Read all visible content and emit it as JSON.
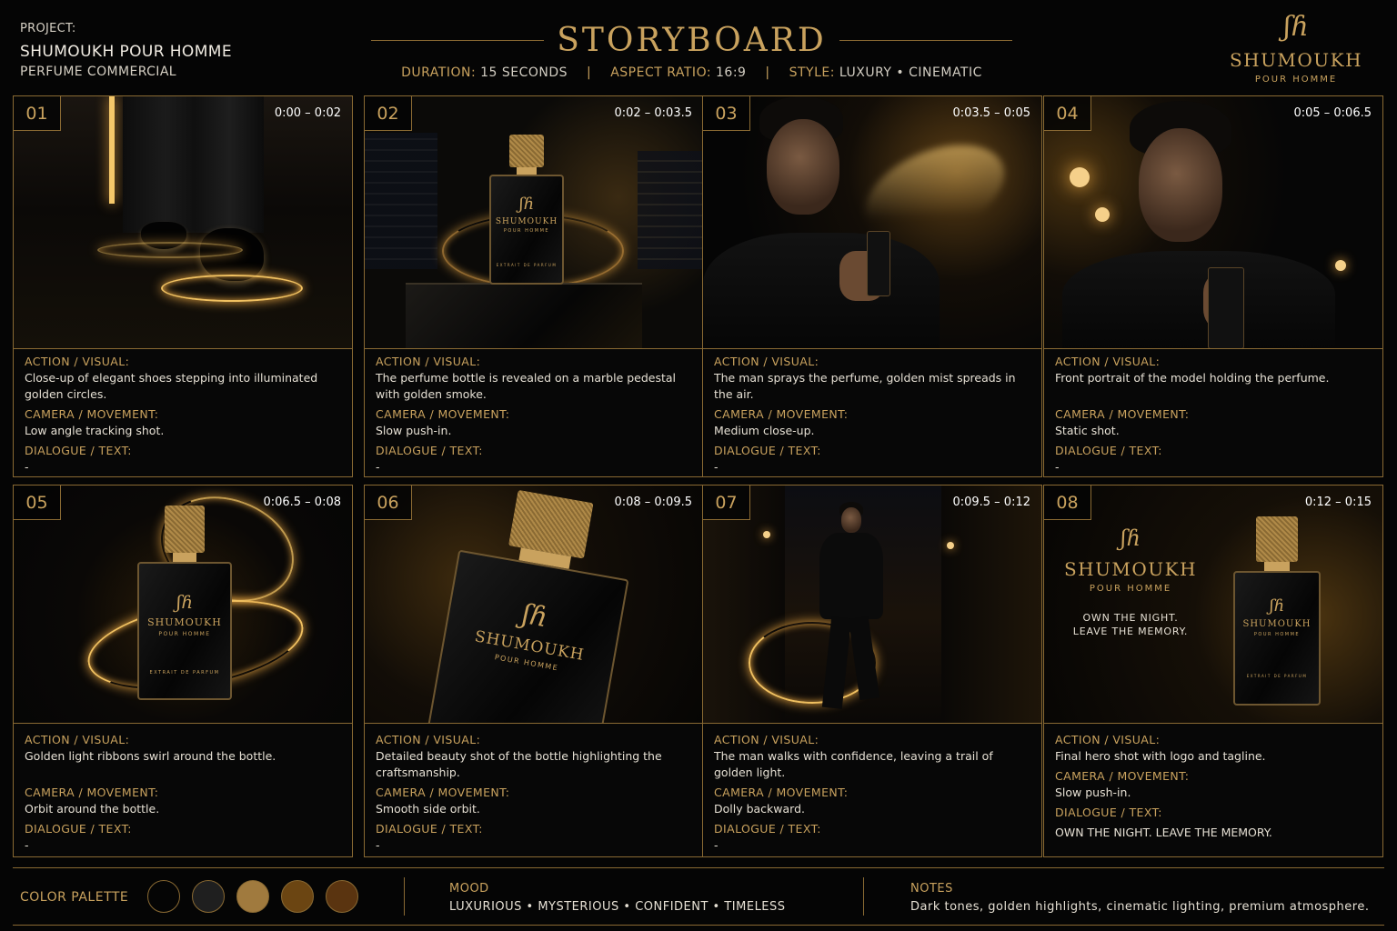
{
  "header": {
    "project_label": "PROJECT:",
    "project_name_bold": "SHUMOUKH",
    "project_name_rest": "POUR HOMME",
    "project_sub": "PERFUME COMMERCIAL",
    "title": "STORYBOARD",
    "duration_key": "DURATION:",
    "duration_val": "15 SECONDS",
    "aspect_key": "ASPECT RATIO:",
    "aspect_val": "16:9",
    "style_key": "STYLE:",
    "style_val": "LUXURY • CINEMATIC",
    "separator": "|"
  },
  "brand": {
    "monogram": "ʃɦ",
    "name": "SHUMOUKH",
    "sub": "POUR HOMME"
  },
  "labels": {
    "action": "ACTION / VISUAL:",
    "camera": "CAMERA / MOVEMENT:",
    "dialogue": "DIALOGUE / TEXT:"
  },
  "bottle_label": {
    "name": "SHUMOUKH",
    "sub": "POUR HOMME",
    "extrait": "EXTRAIT DE PARFUM"
  },
  "panels": [
    {
      "num": "01",
      "time": "0:00 – 0:02",
      "action": "Close-up of elegant shoes stepping into illuminated golden circles.",
      "camera": "Low angle tracking shot.",
      "dialogue": "-"
    },
    {
      "num": "02",
      "time": "0:02 – 0:03.5",
      "action": "The perfume bottle is revealed on a marble pedestal with golden smoke.",
      "camera": "Slow push-in.",
      "dialogue": "-"
    },
    {
      "num": "03",
      "time": "0:03.5 – 0:05",
      "action": "The man sprays the perfume, golden mist spreads in the air.",
      "camera": "Medium close-up.",
      "dialogue": "-"
    },
    {
      "num": "04",
      "time": "0:05 – 0:06.5",
      "action": "Front portrait of the model holding the perfume.",
      "camera": "Static shot.",
      "dialogue": "-"
    },
    {
      "num": "05",
      "time": "0:06.5 – 0:08",
      "action": "Golden light ribbons swirl around the bottle.",
      "camera": "Orbit around the bottle.",
      "dialogue": "-"
    },
    {
      "num": "06",
      "time": "0:08 – 0:09.5",
      "action": "Detailed beauty shot of the bottle highlighting the craftsmanship.",
      "camera": "Smooth side orbit.",
      "dialogue": "-"
    },
    {
      "num": "07",
      "time": "0:09.5 – 0:12",
      "action": "The man walks with confidence, leaving a trail of golden light.",
      "camera": "Dolly backward.",
      "dialogue": "-"
    },
    {
      "num": "08",
      "time": "0:12 – 0:15",
      "action": "Final hero shot with logo and tagline.",
      "camera": "Slow push-in.",
      "dialogue": "OWN THE NIGHT. LEAVE THE MEMORY."
    }
  ],
  "panel8_overlay": {
    "name": "SHUMOUKH",
    "sub": "POUR HOMME",
    "tagline_1": "OWN THE NIGHT.",
    "tagline_2": "LEAVE THE MEMORY."
  },
  "footer": {
    "palette_label": "COLOR PALETTE",
    "palette_colors": [
      "#050505",
      "#1f1f1f",
      "#a07a3e",
      "#6b4512",
      "#5a3410"
    ],
    "mood_label": "MOOD",
    "mood_value": "LUXURIOUS  •  MYSTERIOUS  •  CONFIDENT  •  TIMELESS",
    "notes_label": "NOTES",
    "notes_value": "Dark tones, golden highlights, cinematic lighting, premium atmosphere."
  }
}
